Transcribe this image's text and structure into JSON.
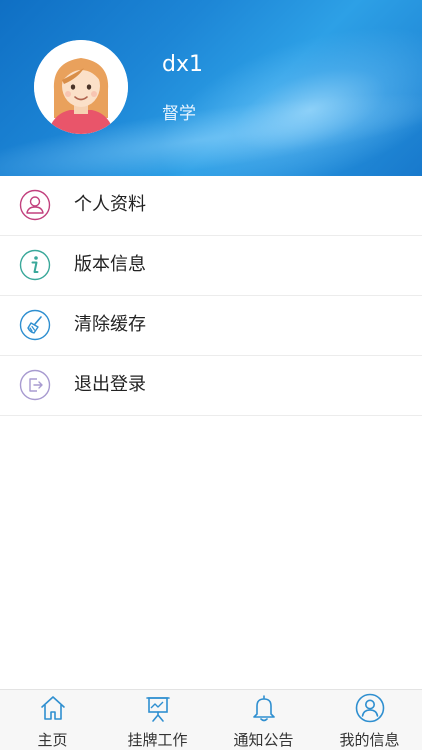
{
  "profile": {
    "username": "dx1",
    "role": "督学"
  },
  "menu": {
    "items": [
      {
        "label": "个人资料",
        "icon": "user-icon",
        "color": "#c2417e"
      },
      {
        "label": "版本信息",
        "icon": "info-icon",
        "color": "#3aa89a"
      },
      {
        "label": "清除缓存",
        "icon": "broom-icon",
        "color": "#2f8fd0"
      },
      {
        "label": "退出登录",
        "icon": "logout-icon",
        "color": "#a89bd0"
      }
    ]
  },
  "tabbar": {
    "items": [
      {
        "label": "主页",
        "icon": "home-icon"
      },
      {
        "label": "挂牌工作",
        "icon": "presentation-board-icon"
      },
      {
        "label": "通知公告",
        "icon": "bell-icon"
      },
      {
        "label": "我的信息",
        "icon": "user-circle-icon"
      }
    ]
  },
  "colors": {
    "header": "#1d86d6",
    "tab_icon": "#2f8fd0"
  }
}
